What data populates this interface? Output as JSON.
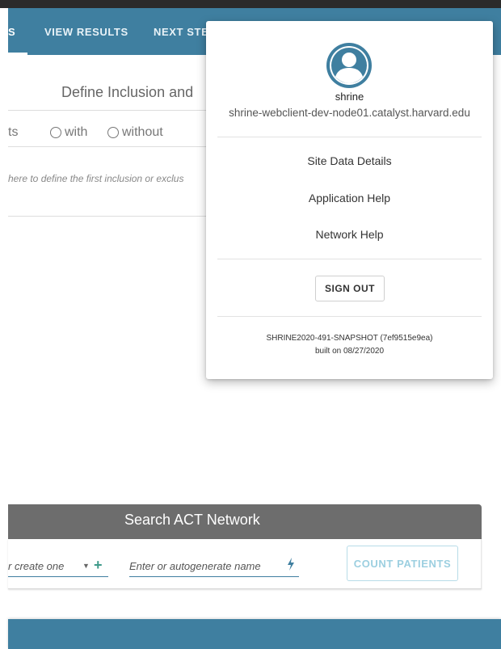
{
  "nav": {
    "tabs": [
      {
        "label": "S"
      },
      {
        "label": "VIEW RESULTS"
      },
      {
        "label": "NEXT STE"
      }
    ]
  },
  "query": {
    "title": "Define Inclusion and",
    "patients_fragment": "ts",
    "radio_with": "with",
    "radio_without": "without",
    "hint": "here to define the first inclusion or exclus"
  },
  "search": {
    "title": "Search ACT Network",
    "select_placeholder": "r create one",
    "name_placeholder": "Enter or autogenerate name",
    "count_label": "COUNT PATIENTS"
  },
  "user_menu": {
    "username": "shrine",
    "hostname": "shrine-webclient-dev-node01.catalyst.harvard.edu",
    "items": [
      {
        "label": "Site Data Details"
      },
      {
        "label": "Application Help"
      },
      {
        "label": "Network Help"
      }
    ],
    "signout_label": "SIGN OUT",
    "version": "SHRINE2020-491-SNAPSHOT (7ef9515e9ea)",
    "built": "built on 08/27/2020"
  },
  "colors": {
    "primary": "#3f7fa0",
    "header_dark": "#6d6d6d",
    "accent_plus": "#3f9a8a"
  },
  "icons": {
    "avatar": "account-circle-icon",
    "add": "plus-icon",
    "generate": "lightning-bolt-icon",
    "dropdown": "caret-down-icon"
  }
}
